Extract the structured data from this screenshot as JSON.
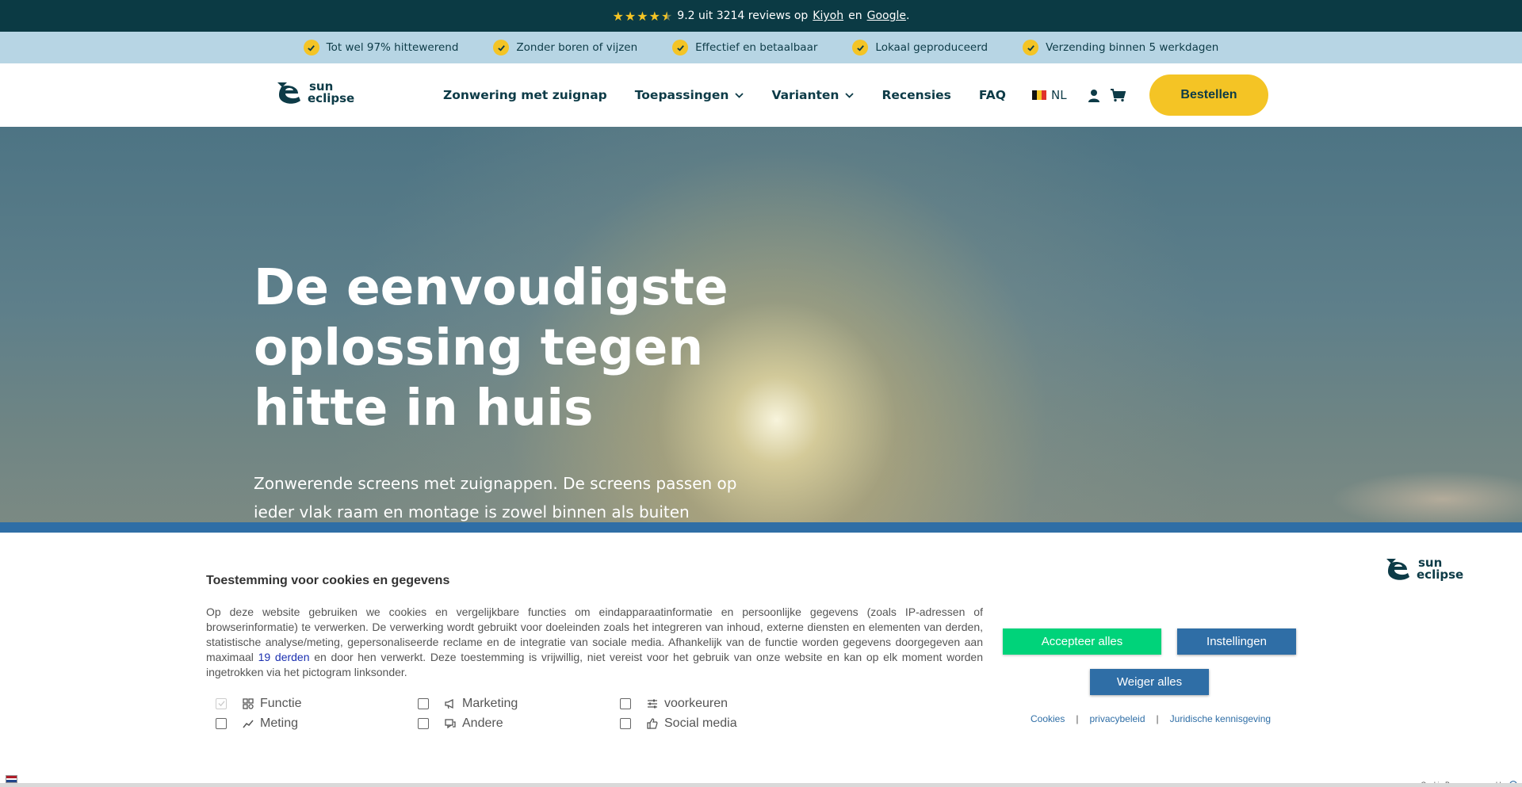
{
  "topbar": {
    "rating_prefix": "9.2 uit 3214 reviews op",
    "link_kiyoh": "Kiyoh",
    "and_text": "en",
    "link_google": "Google",
    "suffix": ".",
    "star_rating": 4.5
  },
  "usps": [
    {
      "label": "Tot wel 97% hittewerend"
    },
    {
      "label": "Zonder boren of vijzen"
    },
    {
      "label": "Effectief en betaalbaar"
    },
    {
      "label": "Lokaal geproduceerd"
    },
    {
      "label": "Verzending binnen 5 werkdagen"
    }
  ],
  "header": {
    "logo_line1": "sun",
    "logo_line2": "eclipse",
    "nav": [
      {
        "label": "Zonwering met zuignap",
        "dropdown": false
      },
      {
        "label": "Toepassingen",
        "dropdown": true
      },
      {
        "label": "Varianten",
        "dropdown": true
      },
      {
        "label": "Recensies",
        "dropdown": false
      },
      {
        "label": "FAQ",
        "dropdown": false
      }
    ],
    "language": "NL",
    "order_button": "Bestellen",
    "colors": {
      "accent": "#f4c425",
      "dark": "#0b3a44",
      "usp_bg": "#b7d5e4"
    }
  },
  "hero": {
    "title": "De eenvoudigste oplossing tegen hitte in huis",
    "subtitle": "Zonwerende screens met zuignappen. De screens passen op ieder vlak raam en montage is zowel binnen als buiten mogelijk."
  },
  "cookie": {
    "title": "Toestemming voor cookies en gegevens",
    "text_part1": "Op deze website gebruiken we cookies en vergelijkbare functies om eindapparaatinformatie en persoonlijke gegevens (zoals IP-adressen of browserinformatie) te verwerken. De verwerking wordt gebruikt voor doeleinden zoals het integreren van inhoud, externe diensten en elementen van derden, statistische analyse/meting, gepersonaliseerde reclame en de integratie van sociale media. Afhankelijk van de functie worden gegevens doorgegeven aan maximaal",
    "text_link": "19 derden",
    "text_part2": "en door hen verwerkt. Deze toestemming is vrijwillig, niet vereist voor het gebruik van onze website en kan op elk moment worden ingetrokken via het pictogram linksonder.",
    "options": [
      {
        "label": "Functie",
        "icon": "function-icon",
        "checked": true,
        "disabled": true
      },
      {
        "label": "Marketing",
        "icon": "megaphone-icon",
        "checked": false,
        "disabled": false
      },
      {
        "label": "voorkeuren",
        "icon": "sliders-icon",
        "checked": false,
        "disabled": false
      },
      {
        "label": "Meting",
        "icon": "chart-icon",
        "checked": false,
        "disabled": false
      },
      {
        "label": "Andere",
        "icon": "chat-icon",
        "checked": false,
        "disabled": false
      },
      {
        "label": "Social media",
        "icon": "thumbs-up-icon",
        "checked": false,
        "disabled": false
      }
    ],
    "accept_all": "Accepteer alles",
    "settings": "Instellingen",
    "reject_all": "Weiger alles",
    "links": [
      "Cookies",
      "privacybeleid",
      "Juridische kennisgeving"
    ],
    "powered_by": "Cookie Banner powered by",
    "colors": {
      "accept": "#00d37a",
      "primary": "#2f6ea6"
    }
  }
}
